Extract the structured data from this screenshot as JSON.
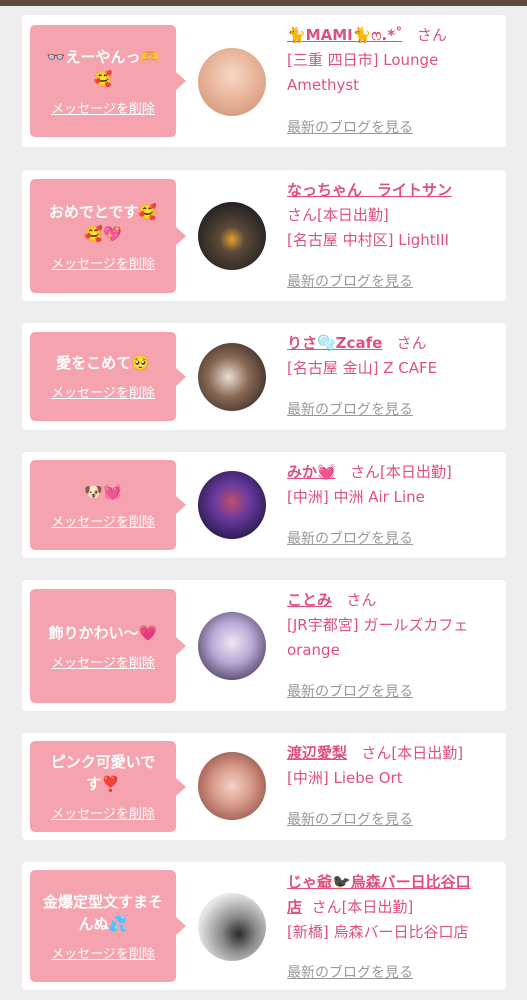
{
  "common": {
    "delete_label": "メッセージを削除",
    "blog_label": "最新のブログを見る",
    "san": "さん",
    "today": "[本日出勤]"
  },
  "entries": [
    {
      "message": "👓えーやんっ🫶🥰",
      "name": "🐈MAMI🐈ෆ.*˚",
      "attendance": "",
      "shop": "[三重 四日市] Lounge Amethyst",
      "avatar_color": "#e8b59a"
    },
    {
      "message": "おめでとです🥰🥰💖",
      "name": "なっちゃん　ライトサン",
      "attendance": "[本日出勤]",
      "shop": "[名古屋 中村区] LightIII",
      "avatar_color": "#3c3430"
    },
    {
      "message": "愛をこめて🥺",
      "name": "りさ🫧Zcafe",
      "attendance": "",
      "shop": "[名古屋 金山] Z CAFE",
      "avatar_color": "#8a6a55"
    },
    {
      "message": "🐶💓",
      "name": "みか💓",
      "attendance": "[本日出勤]",
      "shop": "[中洲] 中洲 Air Line",
      "avatar_color": "#2a1f5a"
    },
    {
      "message": "飾りかわい〜💗",
      "name": "ことみ",
      "attendance": "",
      "shop": "[JR宇都宮] ガールズカフェ orange",
      "avatar_color": "#b9a9d8"
    },
    {
      "message": "ピンク可愛いです❣️",
      "name": "渡辺愛梨",
      "attendance": "[本日出勤]",
      "shop": "[中洲] Liebe Ort",
      "avatar_color": "#d89a8a"
    },
    {
      "message": "金爆定型文すまそんぬ💦",
      "name": "じゃ爺🐦‍⬛烏森バー日比谷口店",
      "attendance": "[本日出勤]",
      "shop": "[新橋] 烏森バー日比谷口店",
      "avatar_color": "#d8d8d8"
    }
  ]
}
